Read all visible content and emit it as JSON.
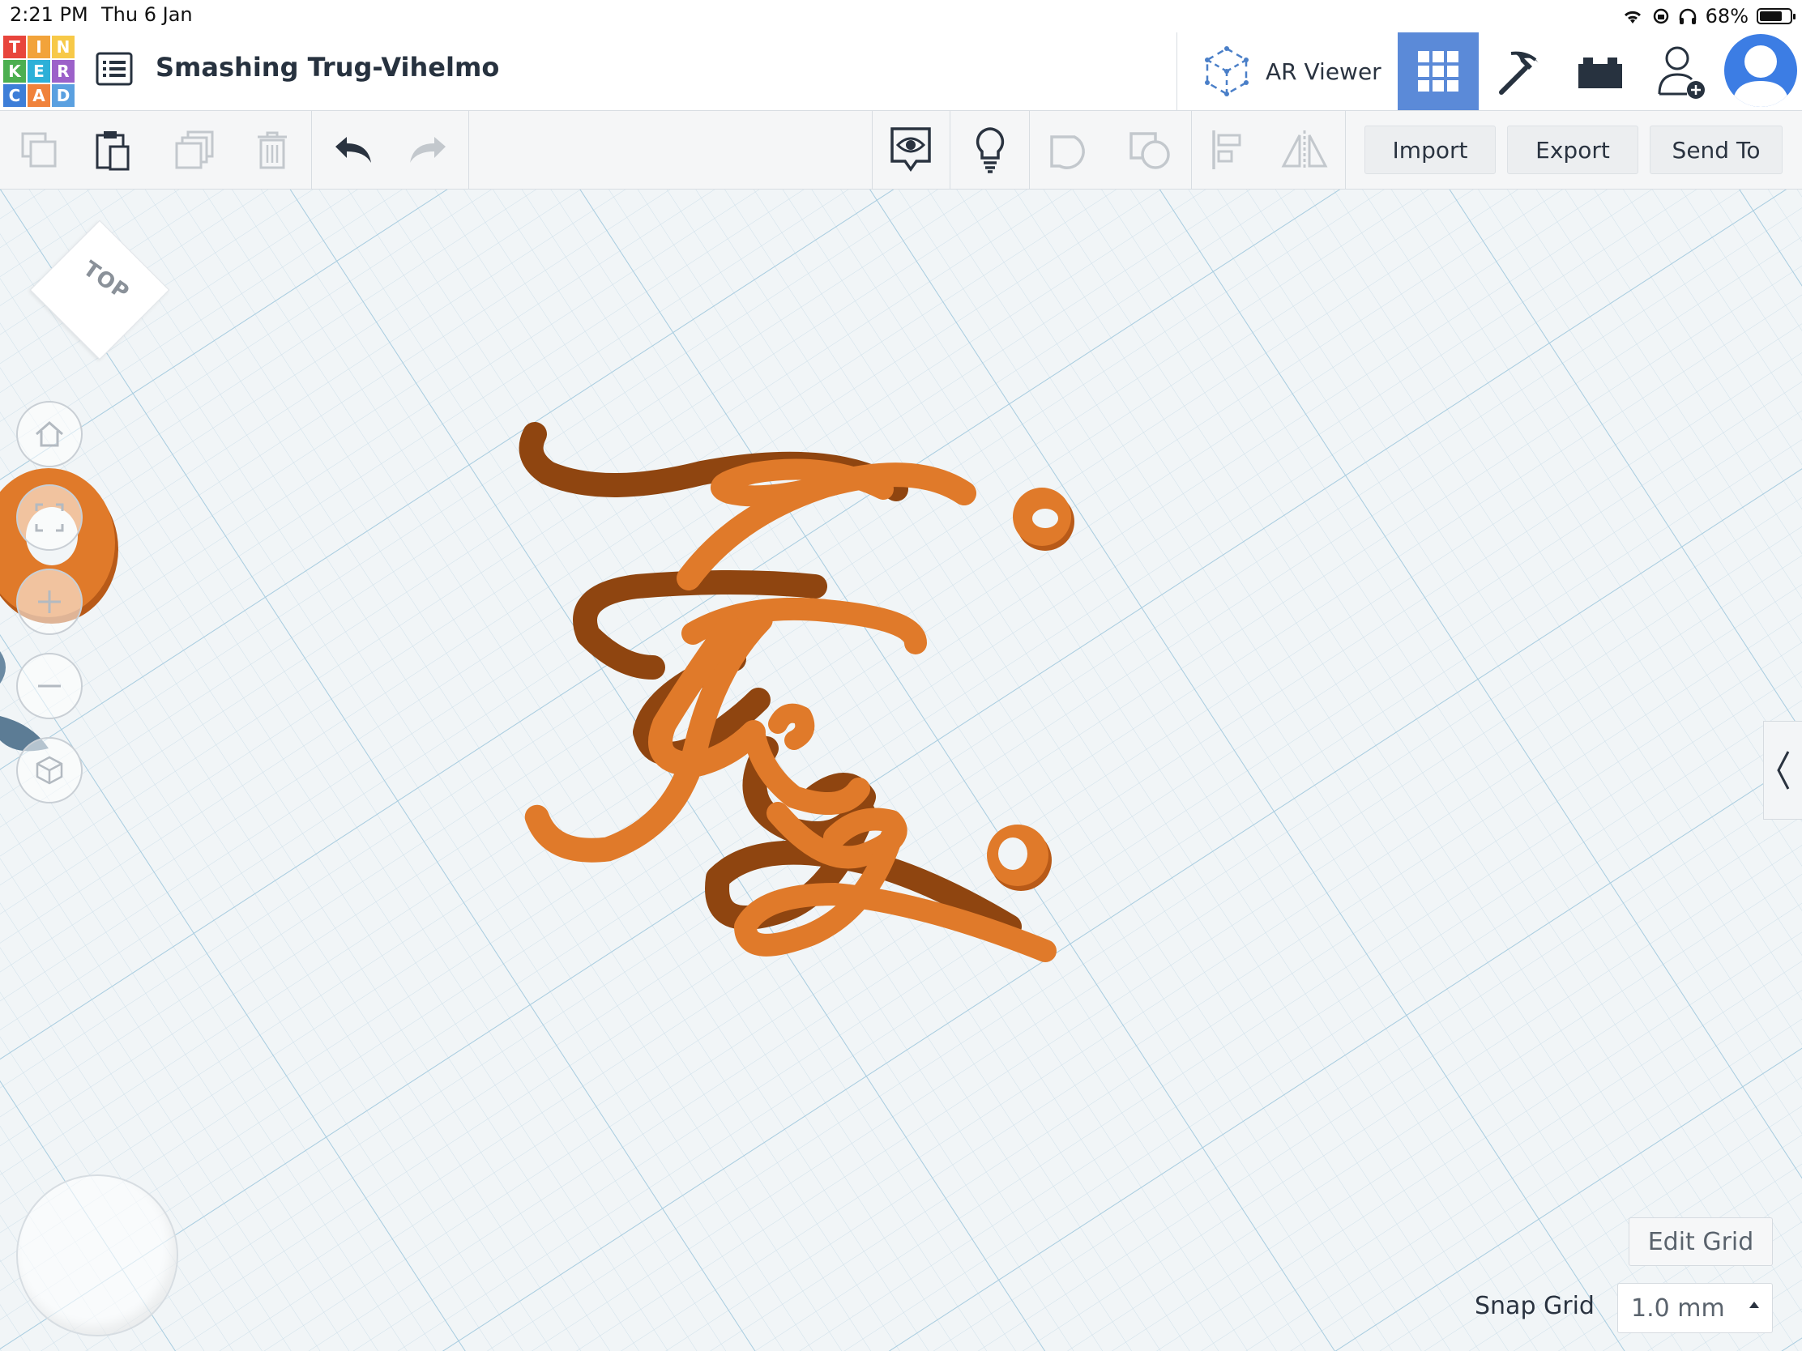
{
  "status_bar": {
    "time": "2:21 PM",
    "date": "Thu 6 Jan",
    "battery": "68%"
  },
  "app": {
    "logo_letters": [
      "T",
      "I",
      "N",
      "K",
      "E",
      "R",
      "C",
      "A",
      "D"
    ],
    "logo_colors": [
      "#e8453c",
      "#f2a33a",
      "#f7c948",
      "#4caf50",
      "#2db0d8",
      "#9c61c9",
      "#3d7ed8",
      "#f0823b",
      "#5aa0e0"
    ],
    "document_title": "Smashing Trug-Vihelmo"
  },
  "header": {
    "ar_viewer_label": "AR Viewer",
    "accent": "#5b8ad8"
  },
  "toolbar": {
    "import_label": "Import",
    "export_label": "Export",
    "send_to_label": "Send To"
  },
  "viewport": {
    "viewcube_label": "TOP",
    "shape_color": "#e07a2a",
    "edit_grid_label": "Edit Grid",
    "snap_grid_label": "Snap Grid",
    "snap_grid_value": "1.0 mm"
  }
}
